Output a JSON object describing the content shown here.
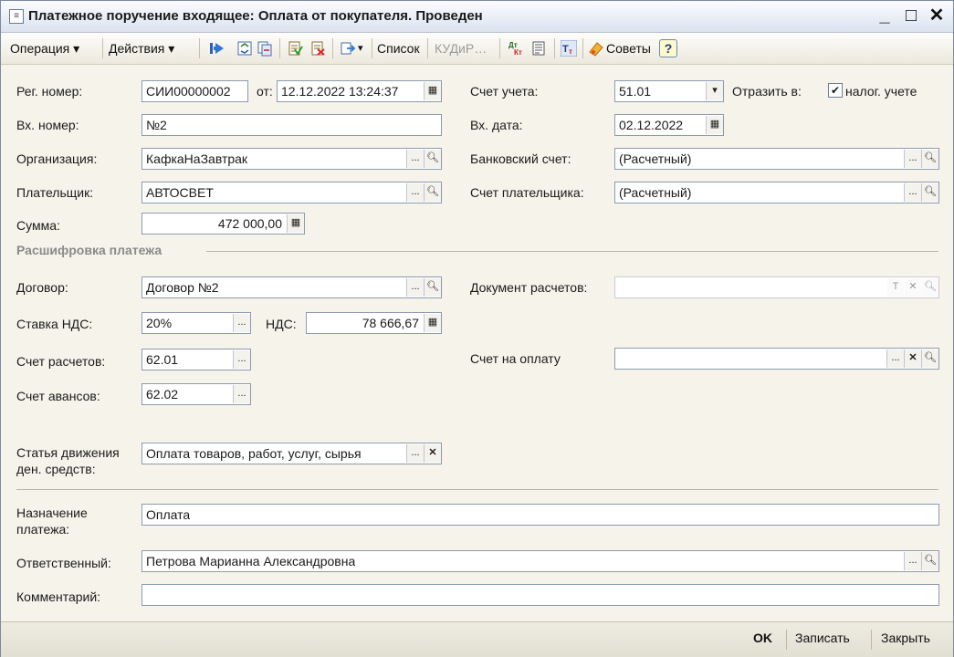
{
  "window": {
    "title": "Платежное поручение входящее: Оплата от покупателя. Проведен",
    "minimize": "_",
    "maximize": "□",
    "close": "✕"
  },
  "toolbar": {
    "operation": "Операция ▾",
    "actions": "Действия ▾",
    "list": "Список",
    "kud": "КУДиР…",
    "dt_kt": "Дт Кт",
    "advice": "Советы",
    "help": "?"
  },
  "form": {
    "reg_number_label": "Рег. номер:",
    "reg_number_value": "СИИ00000002",
    "from_label": "от:",
    "from_value": "12.12.2022 13:24:37",
    "account_label": "Счет учета:",
    "account_value": "51.01",
    "reflect_label": "Отразить в:",
    "tax_accounting_label": "налог. учете",
    "tax_accounting_checked": "✔",
    "in_number_label": "Вх. номер:",
    "in_number_value": "№2",
    "in_date_label": "Вх. дата:",
    "in_date_value": "02.12.2022",
    "org_label": "Организация:",
    "org_value": "КафкаНаЗавтрак",
    "bank_account_label": "Банковский счет:",
    "bank_account_value": "(Расчетный)",
    "payer_label": "Плательщик:",
    "payer_value": "АВТОСВЕТ",
    "payer_account_label": "Счет плательщика:",
    "payer_account_value": "(Расчетный)",
    "amount_label": "Сумма:",
    "amount_value": "472 000,00"
  },
  "decoding": {
    "section_title": "Расшифровка платежа",
    "contract_label": "Договор:",
    "contract_value": "Договор №2",
    "settlement_doc_label": "Документ расчетов:",
    "settlement_doc_value": "",
    "vat_rate_label": "Ставка НДС:",
    "vat_rate_value": "20%",
    "vat_label": "НДС:",
    "vat_value": "78 666,67",
    "settlement_account_label": "Счет расчетов:",
    "settlement_account_value": "62.01",
    "invoice_label": "Счет на оплату",
    "invoice_value": "",
    "advance_account_label": "Счет авансов:",
    "advance_account_value": "62.02",
    "cash_flow_label_1": "Статья движения",
    "cash_flow_label_2": "ден. средств:",
    "cash_flow_value": "Оплата товаров, работ, услуг, сырья"
  },
  "bottom": {
    "purpose_label_1": "Назначение",
    "purpose_label_2": "платежа:",
    "purpose_value": "Оплата",
    "responsible_label": "Ответственный:",
    "responsible_value": "Петрова Марианна Александровна",
    "comment_label": "Комментарий:",
    "comment_value": ""
  },
  "footer": {
    "ok": "OK",
    "save": "Записать",
    "close": "Закрыть"
  },
  "icons": {
    "ellipsis": "...",
    "search": "🔍",
    "clear": "✕",
    "t": "T",
    "calendar": "▦",
    "calculator": "▦",
    "dropdown": "▾"
  }
}
